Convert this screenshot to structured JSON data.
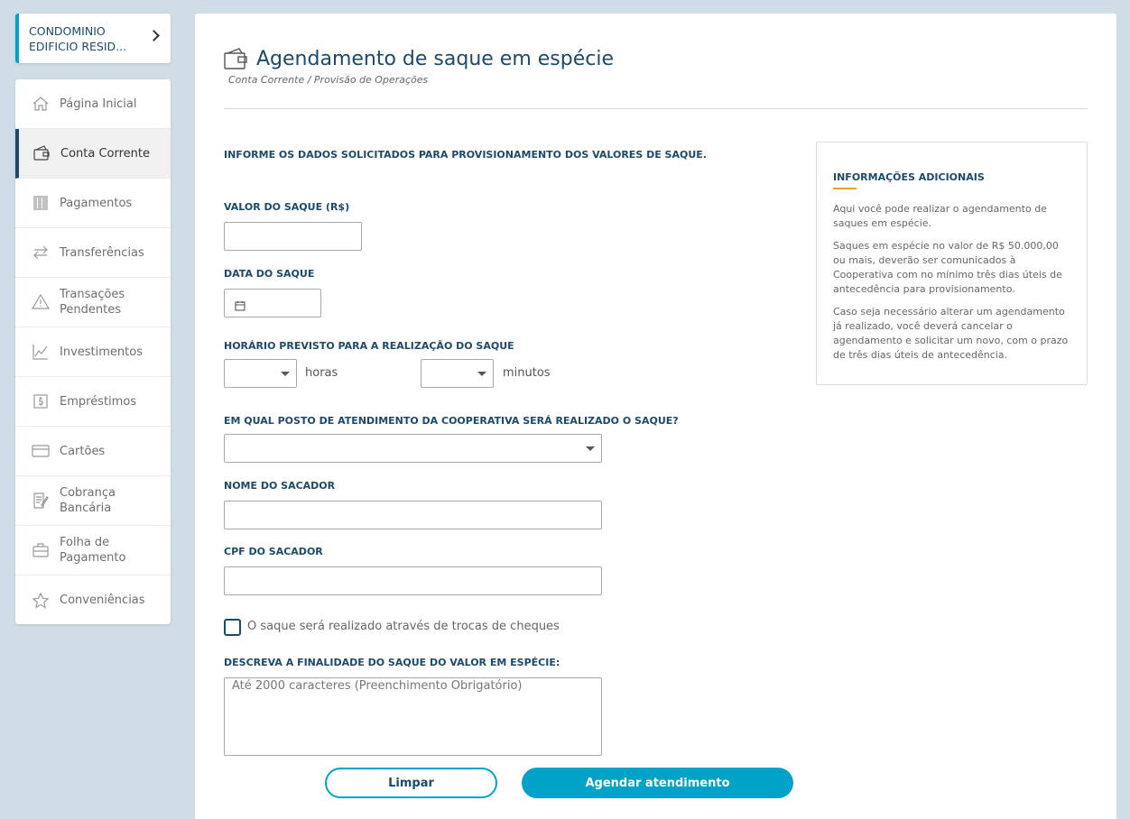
{
  "account": {
    "name": "CONDOMINIO EDIFICIO RESID..."
  },
  "sidebar": {
    "items": [
      {
        "label": "Página Inicial",
        "icon": "home-icon",
        "active": false
      },
      {
        "label": "Conta Corrente",
        "icon": "wallet-icon",
        "active": true
      },
      {
        "label": "Pagamentos",
        "icon": "barcode-icon",
        "active": false
      },
      {
        "label": "Transferências",
        "icon": "transfer-arrows-icon",
        "active": false
      },
      {
        "label": "Transações Pendentes",
        "icon": "warning-icon",
        "active": false
      },
      {
        "label": "Investimentos",
        "icon": "chart-line-icon",
        "active": false
      },
      {
        "label": "Empréstimos",
        "icon": "money-icon",
        "active": false
      },
      {
        "label": "Cartões",
        "icon": "credit-card-icon",
        "active": false
      },
      {
        "label": "Cobrança Bancária",
        "icon": "invoice-icon",
        "active": false
      },
      {
        "label": "Folha de Pagamento",
        "icon": "briefcase-icon",
        "active": false
      },
      {
        "label": "Conveniências",
        "icon": "star-icon",
        "active": false
      }
    ]
  },
  "header": {
    "title": "Agendamento de saque em espécie",
    "breadcrumb": "Conta Corrente / Provisão de Operações"
  },
  "form": {
    "intro": "INFORME OS DADOS SOLICITADOS PARA PROVISIONAMENTO DOS VALORES DE SAQUE.",
    "amount_label": "VALOR DO SAQUE (R$)",
    "amount_value": "",
    "date_label": "DATA DO SAQUE",
    "date_value": "",
    "time_label": "HORÁRIO PREVISTO PARA A REALIZAÇÃO DO SAQUE",
    "hours_label": "horas",
    "hours_value": "",
    "minutes_label": "minutos",
    "minutes_value": "",
    "branch_label": "EM QUAL POSTO DE ATENDIMENTO DA COOPERATIVA SERÁ REALIZADO O SAQUE?",
    "branch_value": "",
    "name_label": "NOME DO SACADOR",
    "name_value": "",
    "cpf_label": "CPF DO SACADOR",
    "cpf_value": "",
    "checks_label": "O saque será realizado através de trocas de cheques",
    "checks_checked": false,
    "purpose_label": "DESCREVA A FINALIDADE DO SAQUE DO VALOR EM ESPÉCIE:",
    "purpose_placeholder": "Até 2000 caracteres (Preenchimento Obrigatório)",
    "clear_label": "Limpar",
    "submit_label": "Agendar atendimento"
  },
  "info": {
    "title": "INFORMAÇÕES ADICIONAIS",
    "paragraphs": [
      "Aqui você pode realizar o agendamento de saques em espécie.",
      "Saques em espécie no valor de R$ 50.000,00 ou mais, deverão ser comunicados à Cooperativa com no mínimo três dias úteis de antecedência para provisionamento.",
      "Caso seja necessário alterar um agendamento já realizado, você deverá cancelar o agendamento e solicitar um novo, com o prazo de três dias úteis de antecedência."
    ]
  },
  "colors": {
    "brand_dark": "#1b4a6b",
    "accent": "#00a3c7",
    "highlight": "#e3a12a",
    "background": "#cfdee6"
  }
}
